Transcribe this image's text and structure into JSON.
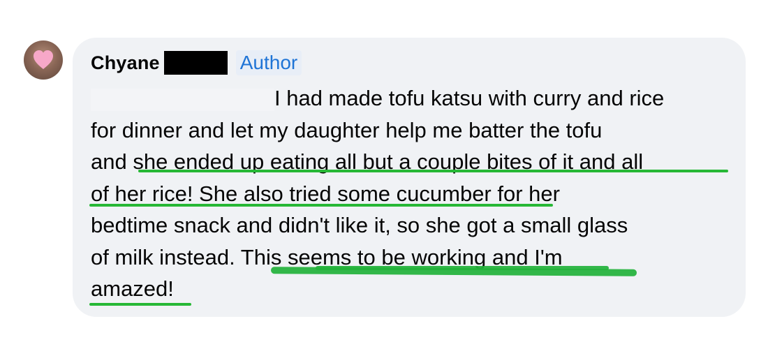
{
  "comment": {
    "author_name": "Chyane",
    "author_badge": "Author",
    "lines": [
      "I had made tofu katsu with curry and rice",
      "for dinner and let my daughter help me batter the tofu",
      "and she ended up eating all but a couple bites of it and all",
      "of her rice! She also tried some cucumber for her",
      "bedtime snack and didn't like it, so she got a small glass",
      "of milk instead. This seems to be working and I'm",
      "amazed!"
    ]
  },
  "colors": {
    "bubble_background": "#f0f2f5",
    "author_badge_text": "#1f74d6",
    "highlight_underline": "#27b836"
  },
  "icons": {
    "avatar": "pink-heart-avatar"
  }
}
